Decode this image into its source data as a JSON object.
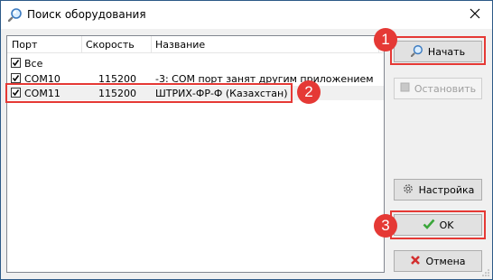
{
  "window": {
    "title": "Поиск оборудования",
    "title_icon": "magnifier-icon",
    "close_icon": "close-icon"
  },
  "list": {
    "columns": [
      "Порт",
      "Скорость",
      "Название"
    ],
    "rows": [
      {
        "port": "Все",
        "speed": "",
        "name": "",
        "checked": true
      },
      {
        "port": "COM10",
        "speed": "115200",
        "name": "-3: COM порт занят другим приложением",
        "checked": true
      },
      {
        "port": "COM11",
        "speed": "115200",
        "name": "ШТРИХ-ФР-Ф (Казахстан)",
        "checked": true,
        "selected": true
      }
    ]
  },
  "buttons": {
    "start": {
      "label": "Начать",
      "icon": "magnifier-icon"
    },
    "stop": {
      "label": "Остановить",
      "icon": "stop-icon",
      "disabled": true
    },
    "settings": {
      "label": "Настройка",
      "icon": "gear-icon"
    },
    "ok": {
      "label": "OK",
      "icon": "checkmark-icon"
    },
    "cancel": {
      "label": "Отмена",
      "icon": "cross-icon"
    }
  },
  "annotations": {
    "badge1": "1",
    "badge2": "2",
    "badge3": "3"
  },
  "colors": {
    "annotation_red": "#e53935",
    "ok_green": "#3aa63a",
    "cancel_red": "#d32f2f"
  }
}
